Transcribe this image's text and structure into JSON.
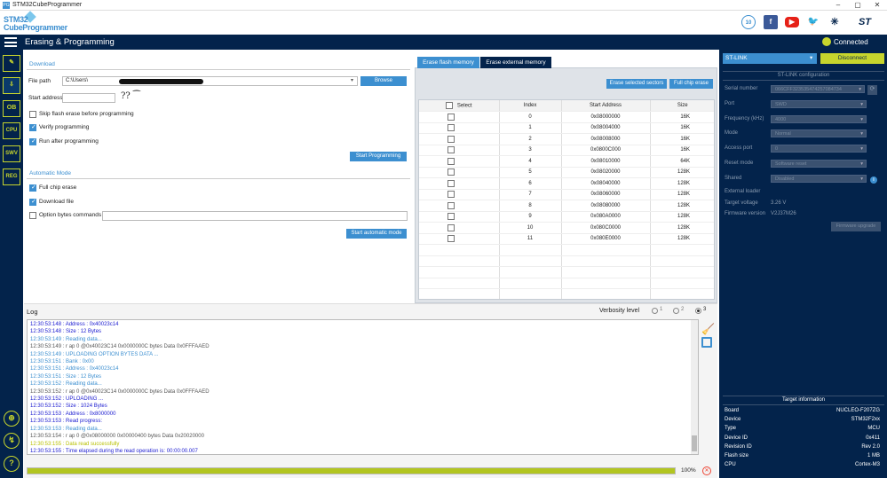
{
  "window": {
    "title": "STM32CubeProgrammer",
    "min": "–",
    "max": "▢",
    "close": "✕"
  },
  "brand": {
    "line1": "STM32",
    "line2": "CubeProgrammer"
  },
  "header": {
    "title": "Erasing & Programming",
    "status": "Connected"
  },
  "topicons": {
    "anniv": "10",
    "facebook": "f",
    "youtube": "▶",
    "twitter": "🐦",
    "network": "✳",
    "st": "ST"
  },
  "sidebar": [
    {
      "label": "✎"
    },
    {
      "label": "⇩"
    },
    {
      "label": "OB"
    },
    {
      "label": "CPU"
    },
    {
      "label": "SWV"
    },
    {
      "label": "REG"
    }
  ],
  "bottom_icons": {
    "globe": "⊕",
    "plug": "↯",
    "help": "?"
  },
  "download": {
    "section": "Download",
    "file_path_label": "File path",
    "file_path_value": "C:\\Users\\",
    "browse": "Browse",
    "start_address_label": "Start address",
    "start_address_value": "",
    "skip_erase": "Skip flash erase before programming",
    "verify": "Verify programming",
    "run_after": "Run after programming",
    "start_btn": "Start Programming"
  },
  "automatic": {
    "section": "Automatic Mode",
    "full_chip": "Full chip erase",
    "download_file": "Download file",
    "option_bytes": "Option bytes commands",
    "start_btn": "Start automatic mode"
  },
  "erase": {
    "tab1": "Erase flash memory",
    "tab2": "Erase external memory",
    "erase_selected": "Erase selected sectors",
    "full_chip": "Full chip erase",
    "columns": [
      "Select",
      "Index",
      "Start Address",
      "Size"
    ],
    "rows": [
      [
        "0",
        "0x08000000",
        "16K"
      ],
      [
        "1",
        "0x08004000",
        "16K"
      ],
      [
        "2",
        "0x08008000",
        "16K"
      ],
      [
        "3",
        "0x0800C000",
        "16K"
      ],
      [
        "4",
        "0x08010000",
        "64K"
      ],
      [
        "5",
        "0x08020000",
        "128K"
      ],
      [
        "6",
        "0x08040000",
        "128K"
      ],
      [
        "7",
        "0x08060000",
        "128K"
      ],
      [
        "8",
        "0x08080000",
        "128K"
      ],
      [
        "9",
        "0x080A0000",
        "128K"
      ],
      [
        "10",
        "0x080C0000",
        "128K"
      ],
      [
        "11",
        "0x080E0000",
        "128K"
      ]
    ]
  },
  "log": {
    "title": "Log",
    "verbosity_label": "Verbosity level",
    "levels": [
      "1",
      "2",
      "3"
    ],
    "lines": [
      {
        "t": "12:30:53:148 :   Address      : 0x40023c14",
        "c": "#1a1ad0"
      },
      {
        "t": "12:30:53:148 :   Size         : 12 Bytes",
        "c": "#1a1ad0"
      },
      {
        "t": "12:30:53:149 : Reading data...",
        "c": "#3c8fd0"
      },
      {
        "t": "12:30:53:149 : r ap 0 @0x40023C14 0x0000000C bytes Data 0x0FFFAAED",
        "c": "#555"
      },
      {
        "t": "12:30:53:149 : UPLOADING OPTION BYTES DATA ...",
        "c": "#3c8fd0"
      },
      {
        "t": "12:30:53:151 :   Bank         : 0x00",
        "c": "#3c8fd0"
      },
      {
        "t": "12:30:53:151 :   Address      : 0x40023c14",
        "c": "#3c8fd0"
      },
      {
        "t": "12:30:53:151 :   Size         : 12 Bytes",
        "c": "#3c8fd0"
      },
      {
        "t": "12:30:53:152 : Reading data...",
        "c": "#3c8fd0"
      },
      {
        "t": "12:30:53:152 : r ap 0 @0x40023C14 0x0000000C bytes Data 0x0FFFAAED",
        "c": "#555"
      },
      {
        "t": "12:30:53:152 : UPLOADING ...",
        "c": "#1a1ad0"
      },
      {
        "t": "12:30:53:152 :   Size         : 1024 Bytes",
        "c": "#1a1ad0"
      },
      {
        "t": "12:30:53:153 :   Address      : 0x8000000",
        "c": "#1a1ad0"
      },
      {
        "t": "12:30:53:153 : Read progress:",
        "c": "#1a1ad0"
      },
      {
        "t": "12:30:53:153 : Reading data...",
        "c": "#3c8fd0"
      },
      {
        "t": "12:30:53:154 : r ap 0 @0x08000000 0x00000400 bytes Data 0x20020000",
        "c": "#555"
      },
      {
        "t": "12:30:53:155 : Data read successfully",
        "c": "#b8c000"
      },
      {
        "t": "12:30:53:155 : Time elapsed during the read operation is: 00:00:00.007",
        "c": "#1a1ad0"
      }
    ]
  },
  "progress": {
    "value": 1.0,
    "label": "100%"
  },
  "stlink": {
    "probe": "ST-LINK",
    "disconnect": "Disconnect",
    "config_title": "ST-LINK configuration",
    "fields": [
      {
        "label": "Serial number",
        "value": "066CFF323535474257084734"
      },
      {
        "label": "Port",
        "value": "SWD"
      },
      {
        "label": "Frequency (kHz)",
        "value": "4000"
      },
      {
        "label": "Mode",
        "value": "Normal"
      },
      {
        "label": "Access port",
        "value": "0"
      },
      {
        "label": "Reset mode",
        "value": "Software reset"
      },
      {
        "label": "Shared",
        "value": "Disabled"
      }
    ],
    "external_loader": "External loader",
    "target_voltage_label": "Target voltage",
    "target_voltage": "3.26 V",
    "firmware_label": "Firmware version",
    "firmware": "V2J37M26",
    "firmware_upgrade": "Firmware upgrade"
  },
  "target": {
    "title": "Target information",
    "rows": [
      [
        "Board",
        "NUCLEO-F207ZG"
      ],
      [
        "Device",
        "STM32F2xx"
      ],
      [
        "Type",
        "MCU"
      ],
      [
        "Device ID",
        "0x411"
      ],
      [
        "Revision ID",
        "Rev 2.0"
      ],
      [
        "Flash size",
        "1 MB"
      ],
      [
        "CPU",
        "Cortex-M3"
      ]
    ]
  },
  "colors": {
    "navy": "#03234b",
    "accent": "#3c8fd0",
    "lime": "#c7d52d"
  }
}
